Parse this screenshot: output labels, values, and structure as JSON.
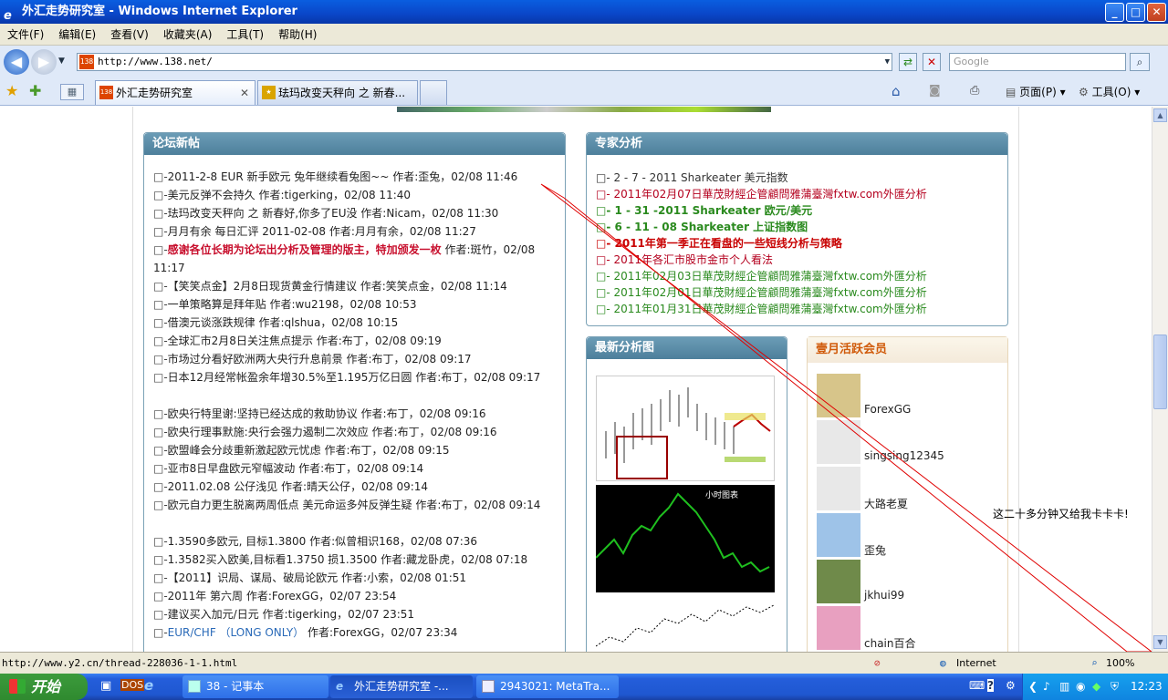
{
  "window": {
    "title": "外汇走势研究室 - Windows Internet Explorer"
  },
  "menu": [
    "文件(F)",
    "编辑(E)",
    "查看(V)",
    "收藏夹(A)",
    "工具(T)",
    "帮助(H)"
  ],
  "address": {
    "url": "http://www.138.net/",
    "favicon": "138"
  },
  "search": {
    "placeholder": "Google"
  },
  "tabs": [
    {
      "label": "外汇走势研究室",
      "active": true
    },
    {
      "label": "珐玛改变天秤向 之 新春...",
      "active": false
    }
  ],
  "toolbar_right": {
    "page": "页面(P)",
    "tools": "工具(O)"
  },
  "forum": {
    "title": "论坛新帖",
    "bullet": "□-",
    "posts": [
      {
        "text": "2011-2-8 EUR 新手欧元 兔年继续看兔图~~",
        "author": " 作者:歪兔",
        "time": "，02/08 11:46"
      },
      {
        "text": "美元反弹不会持久",
        "author": " 作者:tigerking",
        "time": "，02/08 11:40"
      },
      {
        "text": "珐玛改变天秤向 之 新春好,你多了EU没",
        "author": " 作者:Nicam",
        "time": "，02/08 11:30"
      },
      {
        "text": "月月有余 每日汇评 2011-02-08",
        "author": " 作者:月月有余",
        "time": "，02/08 11:27"
      },
      {
        "text": "感谢各位长期为论坛出分析及管理的版主，特加颁发一枚",
        "author": " 作者:斑竹",
        "time": "，02/08 11:17",
        "bold": true
      },
      {
        "text": "【笑笑点金】2月8日现货黄金行情建议",
        "author": " 作者:笑笑点金",
        "time": "，02/08 11:14"
      },
      {
        "text": "一单策略算是拜年贴",
        "author": " 作者:wu2198",
        "time": "，02/08 10:53"
      },
      {
        "text": "借澳元谈涨跌规律",
        "author": " 作者:qlshua",
        "time": "，02/08 10:15"
      },
      {
        "text": "全球汇市2月8日关注焦点提示",
        "author": " 作者:布丁",
        "time": "，02/08 09:19"
      },
      {
        "text": "市场过分看好欧洲两大央行升息前景",
        "author": " 作者:布丁",
        "time": "，02/08 09:17"
      },
      {
        "text": "日本12月经常帐盈余年增30.5%至1.195万亿日圆",
        "author": " 作者:布丁",
        "time": "，02/08 09:17"
      },
      {
        "text": "欧央行特里谢:坚持已经达成的救助协议",
        "author": " 作者:布丁",
        "time": "，02/08 09:16"
      },
      {
        "text": "欧央行理事默施:央行会强力遏制二次效应",
        "author": " 作者:布丁",
        "time": "，02/08 09:16"
      },
      {
        "text": "欧盟峰会分歧重新激起欧元忧虑",
        "author": " 作者:布丁",
        "time": "，02/08 09:15"
      },
      {
        "text": "亚市8日早盘欧元窄幅波动",
        "author": " 作者:布丁",
        "time": "，02/08 09:14"
      },
      {
        "text": "2011.02.08 公仔浅见",
        "author": " 作者:晴天公仔",
        "time": "，02/08 09:14"
      },
      {
        "text": "欧元自力更生脱离两周低点 美元命运多舛反弹生疑",
        "author": " 作者:布丁",
        "time": "，02/08 09:14"
      },
      {
        "text": "1.3590多欧元, 目标1.3800",
        "author": " 作者:似曾相识168",
        "time": "，02/08 07:36"
      },
      {
        "text": "1.3582买入欧美,目标看1.3750 损1.3500",
        "author": " 作者:藏龙卧虎",
        "time": "，02/08 07:18"
      },
      {
        "text": "【2011】识局、谋局、破局论欧元",
        "author": " 作者:小索",
        "time": "，02/08 01:51"
      },
      {
        "text": "2011年 第六周",
        "author": " 作者:ForexGG",
        "time": "，02/07 23:54"
      },
      {
        "text": "建议买入加元/日元",
        "author": " 作者:tigerking",
        "time": "，02/07 23:51"
      },
      {
        "text": "EUR/CHF （LONG ONLY）",
        "author": " 作者:ForexGG",
        "time": "，02/07 23:34",
        "blue": true
      }
    ]
  },
  "expert": {
    "title": "专家分析",
    "items": [
      {
        "text": "□- 2 - 7 - 2011 Sharkeater 美元指数",
        "color": "#333333"
      },
      {
        "text": "□- 2011年02月07日華茂財經企管顧問雅蒲臺灣fxtw.com外匯分析",
        "color": "#b4001e"
      },
      {
        "text": "□- 1 - 31 -2011 Sharkeater 欧元/美元",
        "color": "#2a8a1e",
        "bold": true
      },
      {
        "text": "□- 6 - 11 - 08 Sharkeater 上证指数图",
        "color": "#2a8a1e",
        "bold": true
      },
      {
        "text": "□- 2011年第一季正在看盘的一些短线分析与策略",
        "color": "#c80000",
        "bold": true
      },
      {
        "text": "□- 2011年各汇市股市金市个人看法",
        "color": "#b4001e"
      },
      {
        "text": "□- 2011年02月03日華茂財經企管顧問雅蒲臺灣fxtw.com外匯分析",
        "color": "#2a8a1e"
      },
      {
        "text": "□- 2011年02月01日華茂財經企管顧問雅蒲臺灣fxtw.com外匯分析",
        "color": "#2a8a1e"
      },
      {
        "text": "□- 2011年01月31日華茂財經企管顧問雅蒲臺灣fxtw.com外匯分析",
        "color": "#2a8a1e"
      }
    ]
  },
  "charts": {
    "title": "最新分析图",
    "chart2_label": "小时图表"
  },
  "members": {
    "title": "壹月活跃会员",
    "list": [
      "ForexGG",
      "singsing12345",
      "大路老夏",
      "歪兔",
      "jkhui99",
      "chain百合"
    ]
  },
  "annotation": {
    "note": "这二十多分钟又给我卡卡卡!"
  },
  "status": {
    "url": "http://www.y2.cn/thread-228036-1-1.html",
    "zone": "Internet",
    "zoom": "100%"
  },
  "taskbar": {
    "start": "开始",
    "buttons": [
      "38 - 记事本",
      "外汇走势研究室 -...",
      "2943021: MetaTra..."
    ],
    "clock": "12:23"
  },
  "colors": {
    "panel_header": "#5b8dab",
    "title_bar": "#0a46c8",
    "taskbar": "#245edb"
  }
}
